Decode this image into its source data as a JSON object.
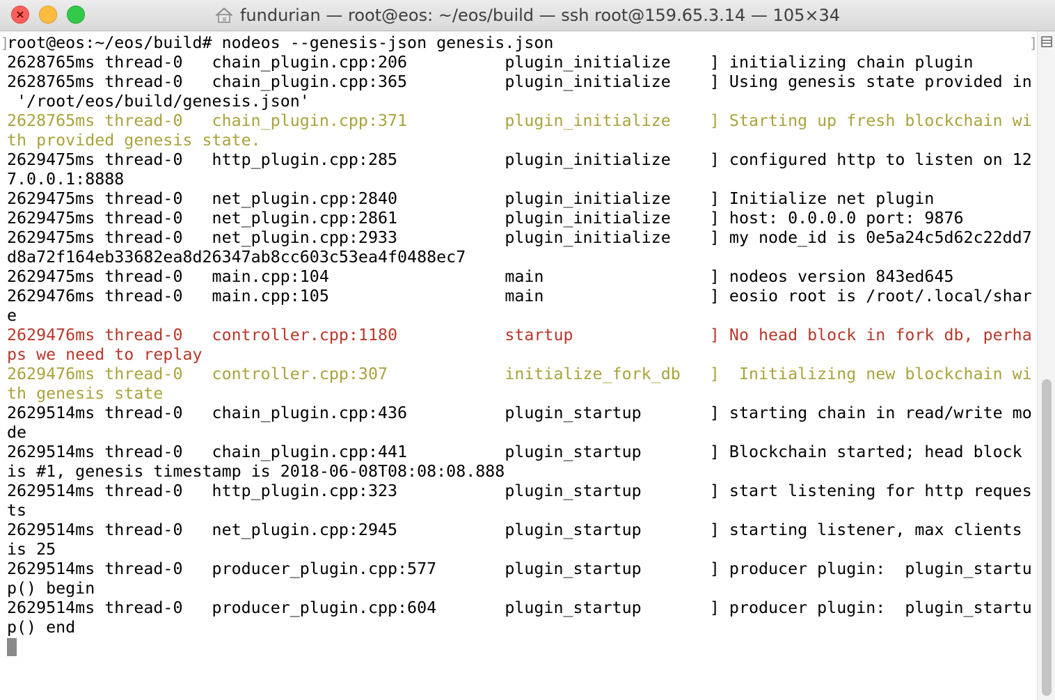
{
  "window": {
    "title": "fundurian — root@eos: ~/eos/build — ssh root@159.65.3.14 — 105×34",
    "icons": {
      "close": "close-icon",
      "minimize": "minimize-icon",
      "zoom": "zoom-icon",
      "home": "home-folder-icon",
      "split": "split-pane-icon"
    },
    "close_glyph": "×",
    "bracket_glyph": "]"
  },
  "colors": {
    "default": "#000000",
    "warn": "#a8a43c",
    "error": "#b8382a",
    "close": "#fc605c",
    "minimize": "#fdbc40",
    "zoom": "#34c84a"
  },
  "terminal": {
    "lines": [
      {
        "text": "root@eos:~/eos/build# nodeos --genesis-json genesis.json",
        "tone": "default"
      },
      {
        "text": "2628765ms thread-0   chain_plugin.cpp:206          plugin_initialize    ] initializing chain plugin",
        "tone": "default"
      },
      {
        "text": "2628765ms thread-0   chain_plugin.cpp:365          plugin_initialize    ] Using genesis state provided in",
        "tone": "default"
      },
      {
        "text": " '/root/eos/build/genesis.json'",
        "tone": "default"
      },
      {
        "text": "2628765ms thread-0   chain_plugin.cpp:371          plugin_initialize    ] Starting up fresh blockchain wi",
        "tone": "warn"
      },
      {
        "text": "th provided genesis state.",
        "tone": "warn"
      },
      {
        "text": "2629475ms thread-0   http_plugin.cpp:285           plugin_initialize    ] configured http to listen on 12",
        "tone": "default"
      },
      {
        "text": "7.0.0.1:8888",
        "tone": "default"
      },
      {
        "text": "2629475ms thread-0   net_plugin.cpp:2840           plugin_initialize    ] Initialize net plugin",
        "tone": "default"
      },
      {
        "text": "2629475ms thread-0   net_plugin.cpp:2861           plugin_initialize    ] host: 0.0.0.0 port: 9876",
        "tone": "default"
      },
      {
        "text": "2629475ms thread-0   net_plugin.cpp:2933           plugin_initialize    ] my node_id is 0e5a24c5d62c22dd7",
        "tone": "default"
      },
      {
        "text": "d8a72f164eb33682ea8d26347ab8cc603c53ea4f0488ec7",
        "tone": "default"
      },
      {
        "text": "2629475ms thread-0   main.cpp:104                  main                 ] nodeos version 843ed645",
        "tone": "default"
      },
      {
        "text": "2629476ms thread-0   main.cpp:105                  main                 ] eosio root is /root/.local/shar",
        "tone": "default"
      },
      {
        "text": "e",
        "tone": "default"
      },
      {
        "text": "2629476ms thread-0   controller.cpp:1180           startup              ] No head block in fork db, perha",
        "tone": "error"
      },
      {
        "text": "ps we need to replay",
        "tone": "error"
      },
      {
        "text": "2629476ms thread-0   controller.cpp:307            initialize_fork_db   ]  Initializing new blockchain wi",
        "tone": "warn"
      },
      {
        "text": "th genesis state",
        "tone": "warn"
      },
      {
        "text": "2629514ms thread-0   chain_plugin.cpp:436          plugin_startup       ] starting chain in read/write mo",
        "tone": "default"
      },
      {
        "text": "de",
        "tone": "default"
      },
      {
        "text": "2629514ms thread-0   chain_plugin.cpp:441          plugin_startup       ] Blockchain started; head block",
        "tone": "default"
      },
      {
        "text": "is #1, genesis timestamp is 2018-06-08T08:08:08.888",
        "tone": "default"
      },
      {
        "text": "2629514ms thread-0   http_plugin.cpp:323           plugin_startup       ] start listening for http reques",
        "tone": "default"
      },
      {
        "text": "ts",
        "tone": "default"
      },
      {
        "text": "2629514ms thread-0   net_plugin.cpp:2945           plugin_startup       ] starting listener, max clients",
        "tone": "default"
      },
      {
        "text": "is 25",
        "tone": "default"
      },
      {
        "text": "2629514ms thread-0   producer_plugin.cpp:577       plugin_startup       ] producer plugin:  plugin_startu",
        "tone": "default"
      },
      {
        "text": "p() begin",
        "tone": "default"
      },
      {
        "text": "2629514ms thread-0   producer_plugin.cpp:604       plugin_startup       ] producer plugin:  plugin_startu",
        "tone": "default"
      },
      {
        "text": "p() end",
        "tone": "default"
      }
    ]
  }
}
